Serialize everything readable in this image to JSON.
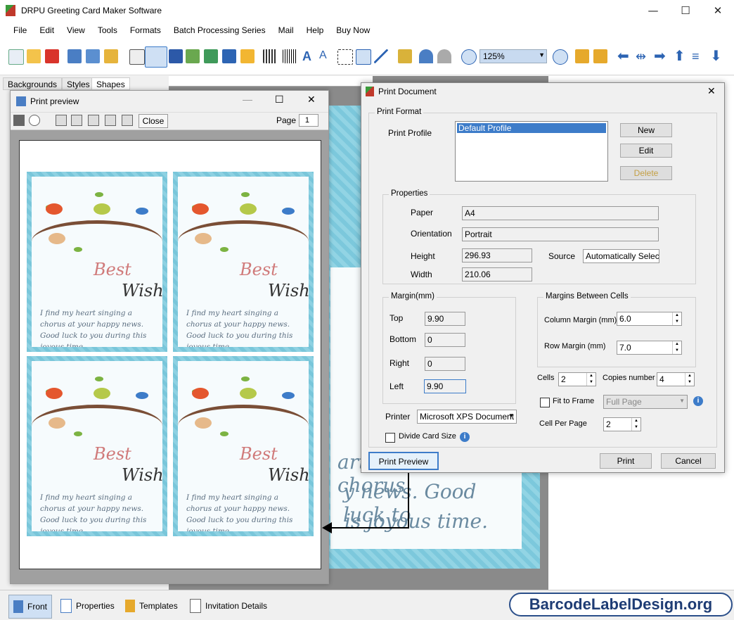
{
  "app": {
    "title": "DRPU Greeting Card Maker Software"
  },
  "menu": [
    "File",
    "Edit",
    "View",
    "Tools",
    "Formats",
    "Batch Processing Series",
    "Mail",
    "Help",
    "Buy Now"
  ],
  "toolbar": {
    "zoom": "125%"
  },
  "left_tabs": [
    "Backgrounds",
    "Styles",
    "Shapes"
  ],
  "card": {
    "best": "Best",
    "wish": "Wish",
    "message": "I find my heart singing a chorus at your happy news. Good luck to you during this joyous time.",
    "bg_line1": "art singing a chorus",
    "bg_line2": "y news. Good luck to",
    "bg_line3": "is joyous time."
  },
  "print_preview": {
    "title": "Print preview",
    "close": "Close",
    "page_label": "Page",
    "page": "1"
  },
  "print_document": {
    "title": "Print Document",
    "print_format": "Print Format",
    "print_profile_label": "Print Profile",
    "profiles": [
      "Default Profile"
    ],
    "new": "New",
    "edit": "Edit",
    "delete": "Delete",
    "properties": "Properties",
    "paper_label": "Paper",
    "paper": "A4",
    "orientation_label": "Orientation",
    "orientation": "Portrait",
    "height_label": "Height",
    "height": "296.93",
    "width_label": "Width",
    "width": "210.06",
    "source_label": "Source",
    "source": "Automatically Select",
    "margin": "Margin(mm)",
    "top_label": "Top",
    "top": "9.90",
    "bottom_label": "Bottom",
    "bottom": "0",
    "right_label": "Right",
    "right": "0",
    "left_label": "Left",
    "left": "9.90",
    "margins_between": "Margins Between Cells",
    "column_margin_label": "Column Margin (mm)",
    "column_margin": "6.0",
    "row_margin_label": "Row Margin (mm)",
    "row_margin": "7.0",
    "cells_label": "Cells",
    "cells": "2",
    "copies_label": "Copies number",
    "copies": "4",
    "fit_to_frame": "Fit to Frame",
    "full_page": "Full Page",
    "cell_per_page_label": "Cell Per Page",
    "cell_per_page": "2",
    "printer_label": "Printer",
    "printer": "Microsoft XPS Document",
    "divide_card": "Divide Card Size",
    "print_preview": "Print Preview",
    "print": "Print",
    "cancel": "Cancel"
  },
  "bottom_tabs": [
    "Front",
    "Properties",
    "Templates",
    "Invitation Details"
  ],
  "brand": "BarcodeLabelDesign.org",
  "colors": {
    "accent": "#3d7cc9",
    "card_border": "#79c6da",
    "brand": "#1e3c74"
  }
}
